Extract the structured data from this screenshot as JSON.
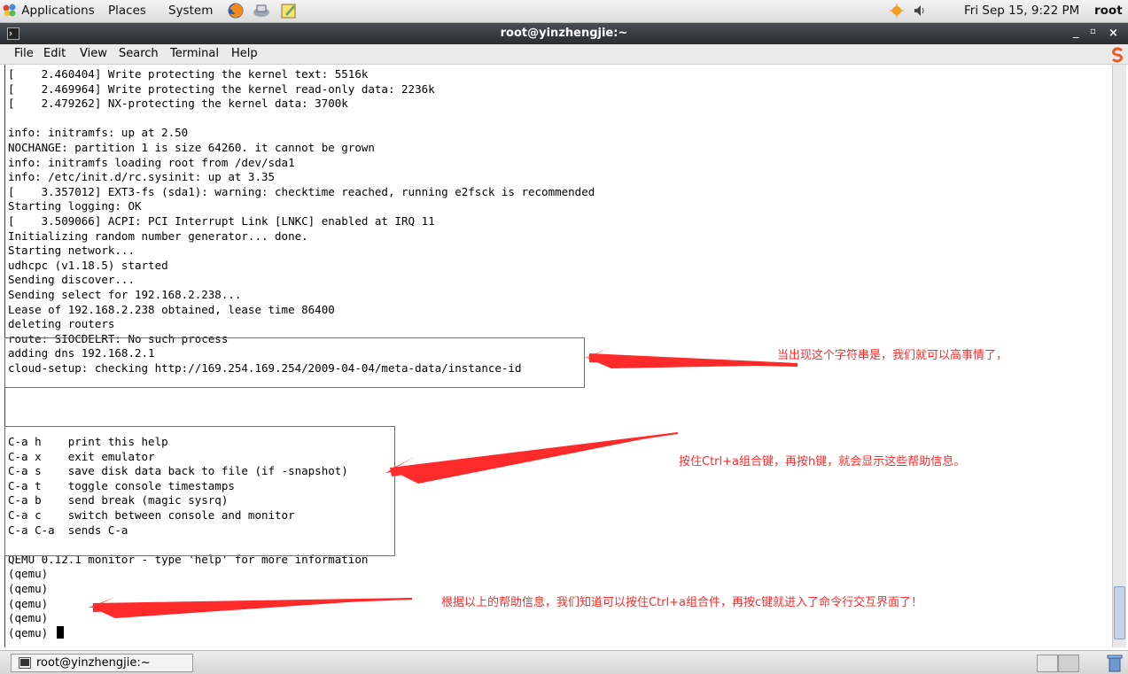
{
  "top_panel": {
    "menus": [
      "Applications",
      "Places",
      "System"
    ],
    "clock": "Fri Sep 15,  9:22 PM",
    "user": "root",
    "icons": [
      "applications-icon",
      "firefox-icon",
      "network-icon",
      "notes-icon",
      "update-notifier-icon",
      "volume-icon"
    ]
  },
  "window": {
    "title": "root@yinzhengjie:~",
    "controls": [
      "minimize-icon",
      "maximize-icon",
      "close-icon"
    ]
  },
  "menubar": [
    "File",
    "Edit",
    "View",
    "Search",
    "Terminal",
    "Help"
  ],
  "terminal": {
    "lines": [
      "[    2.460404] Write protecting the kernel text: 5516k",
      "[    2.469964] Write protecting the kernel read-only data: 2236k",
      "[    2.479262] NX-protecting the kernel data: 3700k",
      "",
      "info: initramfs: up at 2.50",
      "NOCHANGE: partition 1 is size 64260. it cannot be grown",
      "info: initramfs loading root from /dev/sda1",
      "info: /etc/init.d/rc.sysinit: up at 3.35",
      "[    3.357012] EXT3-fs (sda1): warning: checktime reached, running e2fsck is recommended",
      "Starting logging: OK",
      "[    3.509066] ACPI: PCI Interrupt Link [LNKC] enabled at IRQ 11",
      "Initializing random number generator... done.",
      "Starting network...",
      "udhcpc (v1.18.5) started",
      "Sending discover...",
      "Sending select for 192.168.2.238...",
      "Lease of 192.168.2.238 obtained, lease time 86400",
      "deleting routers",
      "route: SIOCDELRT: No such process",
      "adding dns 192.168.2.1",
      "cloud-setup: checking http://169.254.169.254/2009-04-04/meta-data/instance-id",
      "",
      "",
      "",
      "",
      "C-a h    print this help",
      "C-a x    exit emulator",
      "C-a s    save disk data back to file (if -snapshot)",
      "C-a t    toggle console timestamps",
      "C-a b    send break (magic sysrq)",
      "C-a c    switch between console and monitor",
      "C-a C-a  sends C-a",
      "",
      "QEMU 0.12.1 monitor - type 'help' for more information",
      "(qemu)",
      "(qemu)",
      "(qemu)",
      "(qemu)",
      "(qemu) "
    ]
  },
  "annotations": {
    "note1": "当出现这个字符串是，我们就可以高事情了，",
    "note2": "按住Ctrl+a组合键，再按h键，就会显示这些帮助信息。",
    "note3": "根据以上的帮助信息，我们知道可以按住Ctrl+a组合件，再按c键就进入了命令行交互界面了！",
    "color": "#ff2a2a"
  },
  "taskbar": {
    "task_label": "root@yinzhengjie:~"
  }
}
